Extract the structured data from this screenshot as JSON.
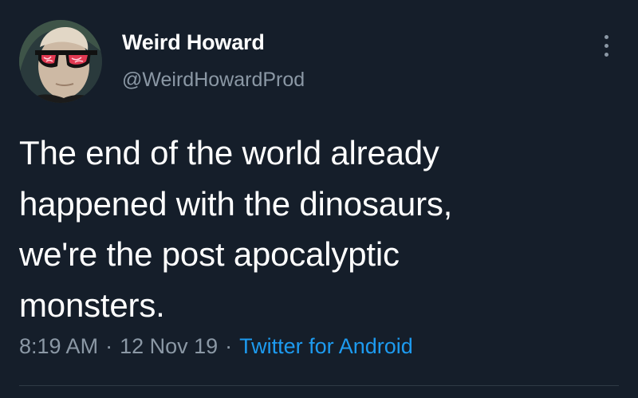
{
  "tweet": {
    "author": {
      "display_name": "Weird Howard",
      "handle": "@WeirdHowardProd",
      "avatar": "avatar-man-with-red-sunglasses"
    },
    "more_icon": "more-vertical-icon",
    "lines": [
      "The end of the world already",
      "happened with the dinosaurs,",
      "we're the post apocalyptic",
      "monsters."
    ],
    "time": "8:19 AM",
    "date": "12 Nov 19",
    "separator": "·",
    "source": "Twitter for Android"
  },
  "colors": {
    "background": "#151e2a",
    "text": "#ffffff",
    "secondary_text": "#8b98a5",
    "link": "#1d9bf0"
  }
}
